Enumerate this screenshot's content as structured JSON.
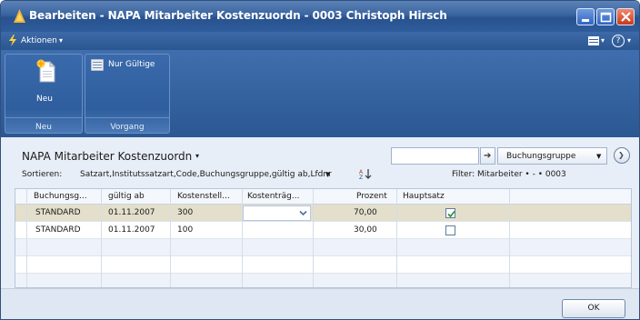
{
  "window": {
    "title": "Bearbeiten - NAPA Mitarbeiter Kostenzuordn - 0003 Christoph Hirsch"
  },
  "menu": {
    "actions_label": "Aktionen",
    "help_label": "?"
  },
  "ribbon": {
    "groups": [
      {
        "label": "Neu",
        "buttons": [
          {
            "label": "Neu",
            "icon": "new-document-icon"
          }
        ]
      },
      {
        "label": "Vorgang",
        "buttons": [
          {
            "label": "Nur Gültige",
            "icon": "filter-valid-icon"
          }
        ]
      }
    ]
  },
  "list": {
    "title": "NAPA Mitarbeiter Kostenzuordn",
    "search_value": "",
    "field_select_value": "Buchungsgruppe",
    "sort_label": "Sortieren:",
    "sort_value": "Satzart,Institutssatzart,Code,Buchungsgruppe,gültig ab,Lfdnr",
    "filter_text": "Filter: Mitarbeiter • - • 0003"
  },
  "table": {
    "columns": [
      "Buchungsg...",
      "gültig ab",
      "Kostenstell...",
      "Kostenträg...",
      "Prozent",
      "Hauptsatz"
    ],
    "rows": [
      {
        "buchungsgruppe": "STANDARD",
        "gueltig_ab": "01.11.2007",
        "kostenstelle": "300",
        "kostentraeger": "",
        "prozent": "70,00",
        "hauptsatz": true
      },
      {
        "buchungsgruppe": "STANDARD",
        "gueltig_ab": "01.11.2007",
        "kostenstelle": "100",
        "kostentraeger": "",
        "prozent": "30,00",
        "hauptsatz": false
      }
    ]
  },
  "footer": {
    "ok_label": "OK"
  },
  "colors": {
    "title_bar": "#3a64a0",
    "ribbon": "#2f5e9e",
    "selected_row": "#e3dfca",
    "close_button": "#c8381c"
  }
}
